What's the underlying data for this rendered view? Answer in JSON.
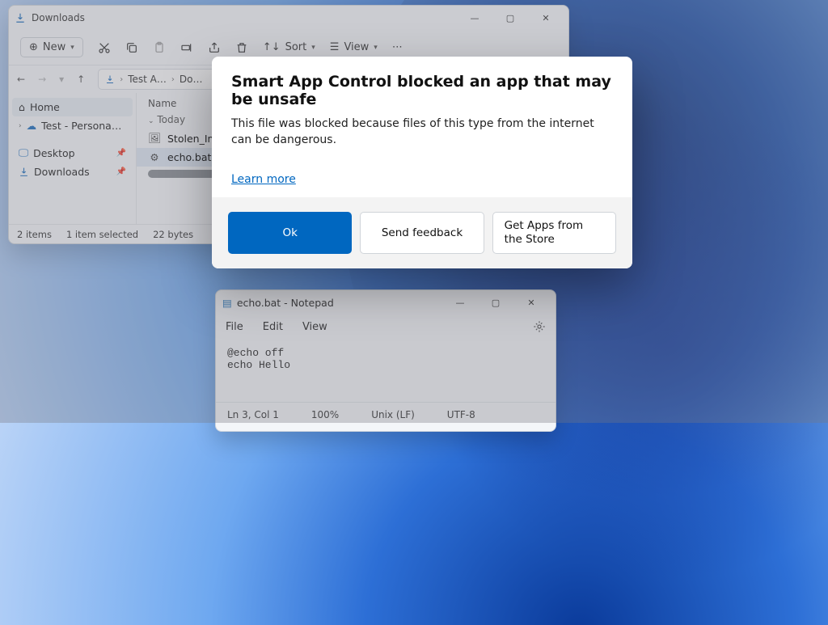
{
  "explorer": {
    "title": "Downloads",
    "toolbar": {
      "new": "New",
      "sort": "Sort",
      "view": "View"
    },
    "breadcrumb": [
      "Test A…",
      "Do…"
    ],
    "sidebar": {
      "home": "Home",
      "test": "Test - Persona…",
      "desktop": "Desktop",
      "downloads": "Downloads"
    },
    "columns": {
      "name": "Name"
    },
    "group": "Today",
    "files": [
      "Stolen_Image…",
      "echo.bat"
    ],
    "status": {
      "items": "2 items",
      "selected": "1 item selected",
      "size": "22 bytes"
    }
  },
  "notepad": {
    "title": "echo.bat - Notepad",
    "menu": {
      "file": "File",
      "edit": "Edit",
      "view": "View"
    },
    "content": "@echo off\necho Hello",
    "status": {
      "pos": "Ln 3, Col 1",
      "zoom": "100%",
      "eol": "Unix (LF)",
      "enc": "UTF-8"
    }
  },
  "dialog": {
    "title": "Smart App Control blocked an app that may be unsafe",
    "message": "This file was blocked because files of this type from the internet can be dangerous.",
    "link": "Learn more",
    "ok": "Ok",
    "feedback": "Send feedback",
    "store": "Get Apps from the Store"
  }
}
